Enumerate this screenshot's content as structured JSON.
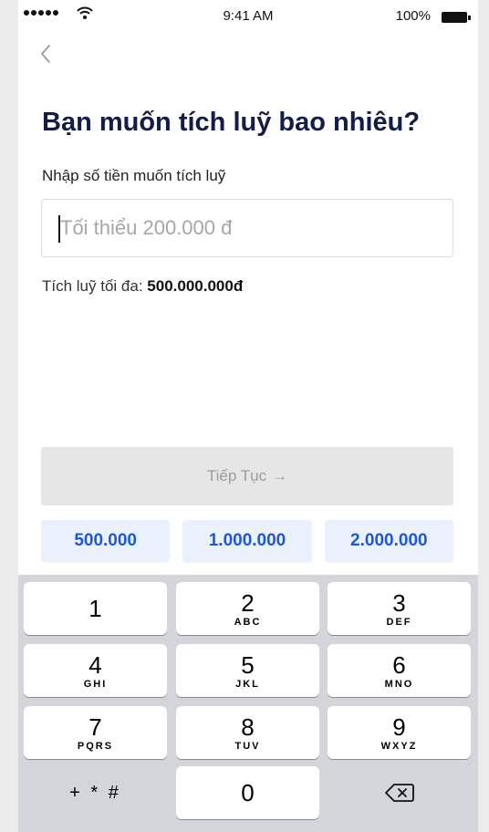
{
  "status_bar": {
    "time": "9:41 AM",
    "battery": "100%"
  },
  "page": {
    "title": "Bạn muốn tích luỹ bao nhiêu?",
    "amount_label": "Nhập số tiền muốn tích luỹ",
    "amount_placeholder": "Tối thiểu 200.000 đ",
    "max_prefix": "Tích luỹ tối đa:",
    "max_value": "500.000.000đ",
    "continue_label": "Tiếp Tục",
    "continue_arrow": "→"
  },
  "quick_amounts": [
    "500.000",
    "1.000.000",
    "2.000.000"
  ],
  "keyboard": {
    "keys": [
      {
        "digit": "1",
        "letters": ""
      },
      {
        "digit": "2",
        "letters": "ABC"
      },
      {
        "digit": "3",
        "letters": "DEF"
      },
      {
        "digit": "4",
        "letters": "GHI"
      },
      {
        "digit": "5",
        "letters": "JKL"
      },
      {
        "digit": "6",
        "letters": "MNO"
      },
      {
        "digit": "7",
        "letters": "PQRS"
      },
      {
        "digit": "8",
        "letters": "TUV"
      },
      {
        "digit": "9",
        "letters": "WXYZ"
      }
    ],
    "symbols": "+ * #",
    "zero": "0",
    "delete_icon": "backspace-icon"
  }
}
